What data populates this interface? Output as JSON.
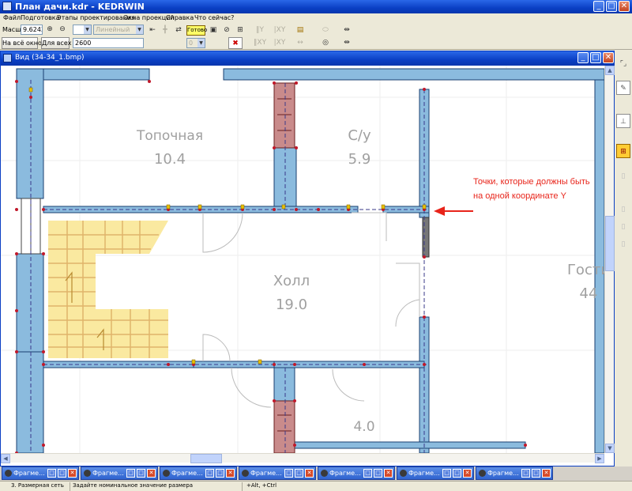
{
  "app": {
    "title": "План дачи.kdr - KEDRWIN",
    "controls": [
      "_",
      "□",
      "✕"
    ]
  },
  "menu": [
    "Файл",
    "Подготовка",
    "Этапы проектирования",
    "Окна проекций",
    "Справка",
    "Что сейчас?"
  ],
  "toolbar": {
    "scale_label": "Масшт",
    "scale_value": "9.6243",
    "fit_window_label": "На всё окно",
    "fit_all_label": "Для всех",
    "dimension_value": "2600",
    "type_select_value": "Линейный",
    "small_select_value": "0",
    "ready_label": "Готово",
    "icons": [
      "zoom-in",
      "zoom-out",
      "arrow-left",
      "plus",
      "arrows",
      "done",
      "frame",
      "circle-cross",
      "grid",
      "align-y",
      "align-xy",
      "align-xy-2",
      "align-y-2",
      "camera",
      "oval",
      "eye",
      "dimension-line",
      "dimension-line-2",
      "delete-cross"
    ]
  },
  "view_window": {
    "title": "Вид (34-34_1.bmp)",
    "controls": [
      "_",
      "□",
      "✕"
    ]
  },
  "plan": {
    "rooms": [
      {
        "name": "Топочная",
        "area": "10.4"
      },
      {
        "name": "С/у",
        "area": "5.9"
      },
      {
        "name": "Холл",
        "area": "19.0"
      },
      {
        "name": "Гости",
        "area": "44"
      },
      {
        "name": "",
        "area": "4.0"
      }
    ],
    "annotation": "Точки, которые должны быть на одной координате Y",
    "colors": {
      "wall": "#8bbbde",
      "stair": "#fae9a0",
      "door_red": "#c98b8b",
      "annotation": "#e8241a",
      "node": "#c0182a"
    }
  },
  "side_toolbar": [
    "corner-marks",
    "edit",
    "stairs",
    "yellow-tool",
    "dim-1",
    "dim-2",
    "dim-3",
    "dim-4"
  ],
  "taskbar": {
    "items": [
      "Фрагме...",
      "Фрагме...",
      "Фрагме...",
      "Фрагме...",
      "Фрагме...",
      "Фрагме...",
      "Фрагме..."
    ]
  },
  "status": {
    "mode": "3. Размерная сеть",
    "hint": "Задайте номинальное значение размера",
    "keys": "+Alt, +Ctrl"
  }
}
